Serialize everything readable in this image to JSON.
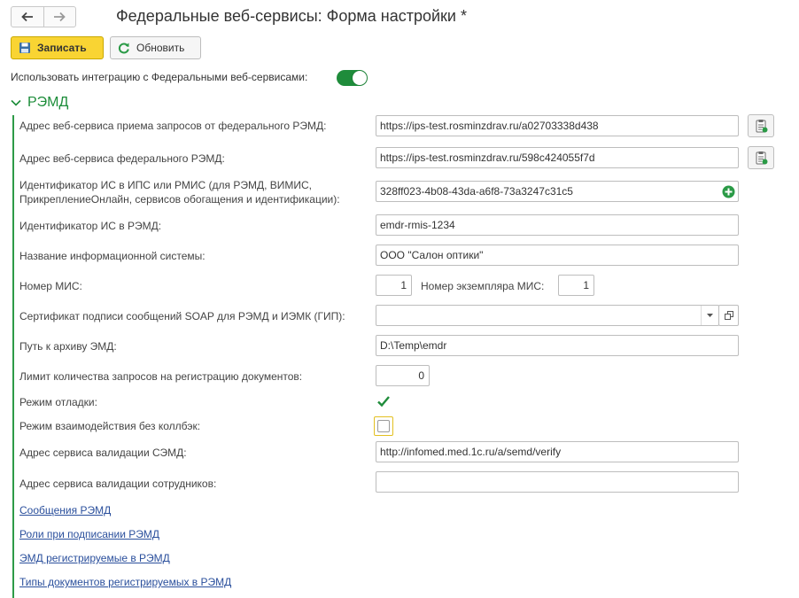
{
  "title": "Федеральные веб-сервисы: Форма настройки *",
  "toolbar": {
    "save_label": "Записать",
    "refresh_label": "Обновить"
  },
  "integration": {
    "label": "Использовать интеграцию с Федеральными веб-сервисами:",
    "enabled": true
  },
  "group": {
    "title": "РЭМД"
  },
  "fields": {
    "request_service": {
      "label": "Адрес веб-сервиса приема запросов от федерального РЭМД:",
      "value": "https://ips-test.rosminzdrav.ru/a02703338d438"
    },
    "federal_service": {
      "label": "Адрес веб-сервиса федерального РЭМД:",
      "value": "https://ips-test.rosminzdrav.ru/598c424055f7d"
    },
    "is_id_ips": {
      "label_line1": "Идентификатор ИС в ИПС или РМИС (для РЭМД, ВИМИС,",
      "label_line2": "ПрикреплениеОнлайн, сервисов обогащения и идентификации):",
      "value": "328ff023-4b08-43da-a6f8-73a3247c31c5"
    },
    "is_id_remd": {
      "label": "Идентификатор ИС в РЭМД:",
      "value": "emdr-rmis-1234"
    },
    "system_name": {
      "label": "Название информационной системы:",
      "value": "ООО \"Салон оптики\""
    },
    "mis_number": {
      "label": "Номер МИС:",
      "value": "1",
      "instance_label": "Номер экземпляра МИС:",
      "instance_value": "1"
    },
    "certificate": {
      "label": "Сертификат подписи сообщений SOAP для РЭМД и ИЭМК (ГИП):",
      "value": ""
    },
    "archive_path": {
      "label": "Путь к архиву ЭМД:",
      "value": "D:\\Temp\\emdr"
    },
    "request_limit": {
      "label": "Лимит количества запросов на регистрацию документов:",
      "value": "0"
    },
    "debug_mode": {
      "label": "Режим отладки:",
      "checked": true
    },
    "no_callback": {
      "label": "Режим взаимодействия без коллбэк:",
      "checked": false
    },
    "semd_validation": {
      "label": "Адрес сервиса валидации СЭМД:",
      "value": "http://infomed.med.1c.ru/a/semd/verify"
    },
    "staff_validation": {
      "label": "Адрес сервиса валидации сотрудников:",
      "value": ""
    }
  },
  "links": {
    "messages": "Сообщения РЭМД",
    "signing_roles": "Роли при подписании РЭМД",
    "registered_emd": "ЭМД регистрируемые в РЭМД",
    "document_types": "Типы документов регистрируемых в РЭМД"
  },
  "colors": {
    "accent_green": "#1f8c3b",
    "primary_button": "#f9d433",
    "link": "#2a4f9c"
  },
  "icons": {
    "back": "arrow-left-icon",
    "forward": "arrow-right-icon",
    "save": "floppy-disk-icon",
    "refresh": "refresh-icon",
    "group_toggle": "chevron-down-icon",
    "clipboard": "clipboard-icon",
    "add": "plus-circle-icon",
    "dropdown": "triangle-down-icon",
    "open": "open-window-icon",
    "check": "check-icon"
  }
}
